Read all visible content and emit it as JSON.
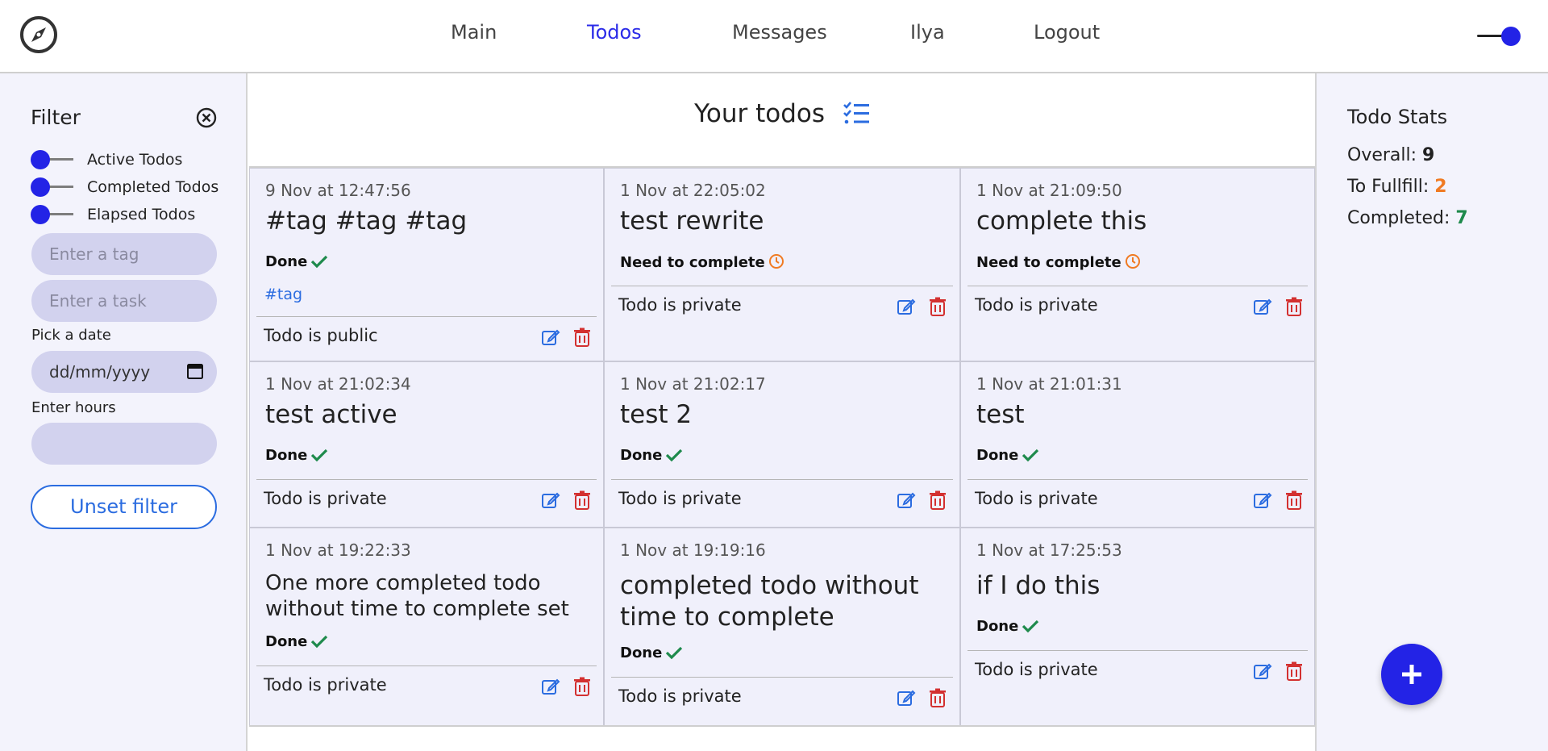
{
  "nav": {
    "items": [
      {
        "label": "Main",
        "active": false
      },
      {
        "label": "Todos",
        "active": true
      },
      {
        "label": "Messages",
        "active": false
      },
      {
        "label": "Ilya",
        "active": false
      },
      {
        "label": "Logout",
        "active": false
      }
    ],
    "logo_icon": "compass-icon",
    "theme_toggle_icon": "toggle-switch"
  },
  "filter": {
    "title": "Filter",
    "close_icon": "close-circle-icon",
    "toggles": [
      {
        "label": "Active Todos"
      },
      {
        "label": "Completed Todos"
      },
      {
        "label": "Elapsed Todos"
      }
    ],
    "tag_placeholder": "Enter a tag",
    "task_placeholder": "Enter a task",
    "date_label": "Pick a date",
    "date_placeholder": "dd/mm/yyyy",
    "hours_label": "Enter hours",
    "hours_value": "",
    "unset_label": "Unset filter"
  },
  "main": {
    "title": "Your todos",
    "title_icon": "checklist-icon",
    "todos": [
      {
        "date": "9 Nov at 12:47:56",
        "title": "#tag #tag #tag",
        "status": "Done",
        "status_icon": "check-icon",
        "tag": "#tag",
        "privacy": "Todo is public"
      },
      {
        "date": "1 Nov at 22:05:02",
        "title": "test rewrite",
        "status": "Need to complete",
        "status_icon": "clock-icon",
        "privacy": "Todo is private"
      },
      {
        "date": "1 Nov at 21:09:50",
        "title": "complete this",
        "status": "Need to complete",
        "status_icon": "clock-icon",
        "privacy": "Todo is private"
      },
      {
        "date": "1 Nov at 21:02:34",
        "title": "test active",
        "status": "Done",
        "status_icon": "check-icon",
        "privacy": "Todo is private"
      },
      {
        "date": "1 Nov at 21:02:17",
        "title": "test 2",
        "status": "Done",
        "status_icon": "check-icon",
        "privacy": "Todo is private"
      },
      {
        "date": "1 Nov at 21:01:31",
        "title": "test",
        "status": "Done",
        "status_icon": "check-icon",
        "privacy": "Todo is private"
      },
      {
        "date": "1 Nov at 19:22:33",
        "title": "One more completed todo without time to complete set",
        "status": "Done",
        "status_icon": "check-icon",
        "privacy": "Todo is private"
      },
      {
        "date": "1 Nov at 19:19:16",
        "title": "completed todo without time to complete",
        "status": "Done",
        "status_icon": "check-icon",
        "privacy": "Todo is private"
      },
      {
        "date": "1 Nov at 17:25:53",
        "title": "if I do this",
        "status": "Done",
        "status_icon": "check-icon",
        "privacy": "Todo is private"
      }
    ]
  },
  "stats": {
    "title": "Todo Stats",
    "overall_label": "Overall:",
    "overall_value": "9",
    "tofulfill_label": "To Fullfill:",
    "tofulfill_value": "2",
    "completed_label": "Completed:",
    "completed_value": "7",
    "add_icon": "plus-icon"
  },
  "colors": {
    "accent": "#2323e6",
    "link": "#2b6ce0",
    "done": "#1e8a4c",
    "pending": "#f07a22",
    "delete": "#d33030",
    "card_bg": "#f0f0fb"
  }
}
